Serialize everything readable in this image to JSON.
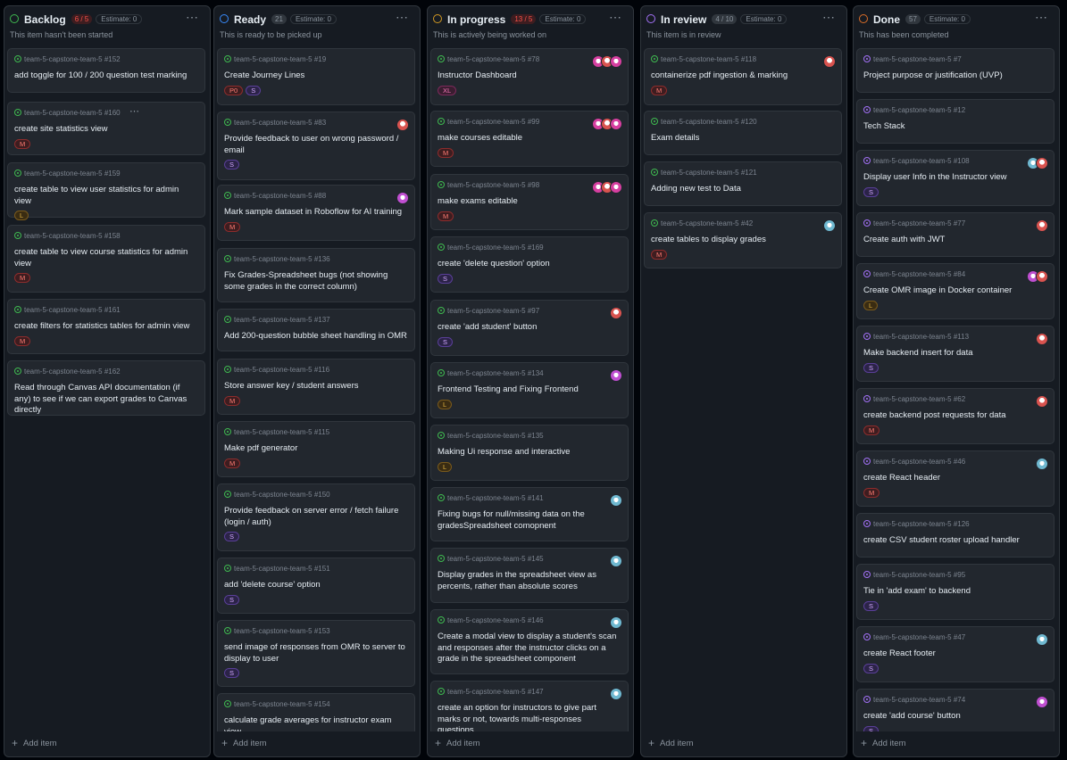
{
  "board": {
    "add_item_label": "Add item",
    "columns": [
      {
        "name": "Backlog",
        "status_color": "#3fb950",
        "count": "6 / 5",
        "count_over": true,
        "estimate": "Estimate: 0",
        "description": "This item hasn't been started",
        "cards": [
          {
            "ref": "team-5-capstone-team-5 #152",
            "title": "add toggle for 100 / 200 question test marking",
            "labels": [],
            "avatars": []
          },
          {
            "ref": "team-5-capstone-team-5 #160",
            "title": "create site statistics view",
            "labels": [
              "M"
            ],
            "avatars": [],
            "menu": true
          },
          {
            "ref": "team-5-capstone-team-5 #159",
            "title": "create table to view user statistics for admin view",
            "labels": [
              "L"
            ],
            "avatars": []
          },
          {
            "ref": "team-5-capstone-team-5 #158",
            "title": "create table to view course statistics for admin view",
            "labels": [
              "M"
            ],
            "avatars": []
          },
          {
            "ref": "team-5-capstone-team-5 #161",
            "title": "create filters for statistics tables for admin view",
            "labels": [
              "M"
            ],
            "avatars": []
          },
          {
            "ref": "team-5-capstone-team-5 #162",
            "title": "Read through Canvas API documentation (if any) to see if we can export grades to Canvas directly",
            "labels": [],
            "avatars": []
          }
        ]
      },
      {
        "name": "Ready",
        "status_color": "#388bfd",
        "count": "21",
        "count_over": false,
        "estimate": "Estimate: 0",
        "description": "This is ready to be picked up",
        "cards": [
          {
            "ref": "team-5-capstone-team-5 #19",
            "title": "Create Journey Lines",
            "labels": [
              "P0",
              "S"
            ],
            "avatars": []
          },
          {
            "ref": "team-5-capstone-team-5 #83",
            "title": "Provide feedback to user on wrong password / email",
            "labels": [
              "S"
            ],
            "avatars": [
              "red"
            ]
          },
          {
            "ref": "team-5-capstone-team-5 #88",
            "title": "Mark sample dataset in Roboflow for AI training",
            "labels": [
              "M"
            ],
            "avatars": [
              "mag"
            ]
          },
          {
            "ref": "team-5-capstone-team-5 #136",
            "title": "Fix Grades-Spreadsheet bugs (not showing some grades in the correct column)",
            "labels": [],
            "avatars": []
          },
          {
            "ref": "team-5-capstone-team-5 #137",
            "title": "Add 200-question bubble sheet handling in OMR",
            "labels": [],
            "avatars": []
          },
          {
            "ref": "team-5-capstone-team-5 #116",
            "title": "Store answer key / student answers",
            "labels": [
              "M"
            ],
            "avatars": []
          },
          {
            "ref": "team-5-capstone-team-5 #115",
            "title": "Make pdf generator",
            "labels": [
              "M"
            ],
            "avatars": []
          },
          {
            "ref": "team-5-capstone-team-5 #150",
            "title": "Provide feedback on server error / fetch failure (login / auth)",
            "labels": [
              "S"
            ],
            "avatars": []
          },
          {
            "ref": "team-5-capstone-team-5 #151",
            "title": "add 'delete course' option",
            "labels": [
              "S"
            ],
            "avatars": []
          },
          {
            "ref": "team-5-capstone-team-5 #153",
            "title": "send image of responses from OMR to server to display to user",
            "labels": [
              "S"
            ],
            "avatars": []
          },
          {
            "ref": "team-5-capstone-team-5 #154",
            "title": "calculate grade averages for instructor exam view",
            "labels": [],
            "avatars": []
          }
        ]
      },
      {
        "name": "In progress",
        "status_color": "#d29922",
        "count": "13 / 5",
        "count_over": true,
        "estimate": "Estimate: 0",
        "description": "This is actively being worked on",
        "cards": [
          {
            "ref": "team-5-capstone-team-5 #78",
            "title": "Instructor Dashboard",
            "labels": [
              "XL"
            ],
            "avatars": [
              "pink",
              "red",
              "pink"
            ]
          },
          {
            "ref": "team-5-capstone-team-5 #99",
            "title": "make courses editable",
            "labels": [
              "M"
            ],
            "avatars": [
              "pink",
              "red",
              "pink"
            ]
          },
          {
            "ref": "team-5-capstone-team-5 #98",
            "title": "make exams editable",
            "labels": [
              "M"
            ],
            "avatars": [
              "pink",
              "red",
              "pink"
            ]
          },
          {
            "ref": "team-5-capstone-team-5 #169",
            "title": "create 'delete question' option",
            "labels": [
              "S"
            ],
            "avatars": []
          },
          {
            "ref": "team-5-capstone-team-5 #97",
            "title": "create 'add student' button",
            "labels": [
              "S"
            ],
            "avatars": [
              "red"
            ]
          },
          {
            "ref": "team-5-capstone-team-5 #134",
            "title": "Frontend Testing and Fixing Frontend",
            "labels": [
              "L"
            ],
            "avatars": [
              "mag"
            ]
          },
          {
            "ref": "team-5-capstone-team-5 #135",
            "title": "Making Ui response and interactive",
            "labels": [
              "L"
            ],
            "avatars": []
          },
          {
            "ref": "team-5-capstone-team-5 #141",
            "title": "Fixing bugs for null/missing data on the gradesSpreadsheet comopnent",
            "labels": [],
            "avatars": [
              "cyan"
            ]
          },
          {
            "ref": "team-5-capstone-team-5 #145",
            "title": "Display grades in the spreadsheet view as percents, rather than absolute scores",
            "labels": [],
            "avatars": [
              "cyan"
            ]
          },
          {
            "ref": "team-5-capstone-team-5 #146",
            "title": "Create a modal view to display a student's scan and responses after the instructor clicks on a grade in the spreadsheet component",
            "labels": [],
            "avatars": [
              "cyan"
            ]
          },
          {
            "ref": "team-5-capstone-team-5 #147",
            "title": "create an option for instructors to give part marks or not, towards multi-responses questions.",
            "labels": [],
            "avatars": [
              "cyan"
            ]
          }
        ]
      },
      {
        "name": "In review",
        "status_color": "#a371f7",
        "count": "4 / 10",
        "count_over": false,
        "estimate": "Estimate: 0",
        "description": "This item is in review",
        "cards": [
          {
            "ref": "team-5-capstone-team-5 #118",
            "title": "containerize pdf ingestion & marking",
            "labels": [
              "M"
            ],
            "avatars": [
              "red"
            ]
          },
          {
            "ref": "team-5-capstone-team-5 #120",
            "title": "Exam details",
            "labels": [],
            "avatars": []
          },
          {
            "ref": "team-5-capstone-team-5 #121",
            "title": "Adding new test to Data",
            "labels": [],
            "avatars": []
          },
          {
            "ref": "team-5-capstone-team-5 #42",
            "title": "create tables to display grades",
            "labels": [
              "M"
            ],
            "avatars": [
              "cyan"
            ]
          }
        ]
      },
      {
        "name": "Done",
        "status_color": "#db6d28",
        "count": "57",
        "count_over": false,
        "estimate": "Estimate: 0",
        "description": "This has been completed",
        "cards": [
          {
            "ref": "team-5-capstone-team-5 #7",
            "title": "Project purpose or justification (UVP)",
            "labels": [],
            "avatars": []
          },
          {
            "ref": "team-5-capstone-team-5 #12",
            "title": "Tech Stack",
            "labels": [],
            "avatars": []
          },
          {
            "ref": "team-5-capstone-team-5 #108",
            "title": "Display user Info in the Instructor view",
            "labels": [
              "S"
            ],
            "avatars": [
              "cyan",
              "red"
            ]
          },
          {
            "ref": "team-5-capstone-team-5 #77",
            "title": "Create auth with JWT",
            "labels": [],
            "avatars": [
              "red"
            ]
          },
          {
            "ref": "team-5-capstone-team-5 #84",
            "title": "Create OMR image in Docker container",
            "labels": [
              "L"
            ],
            "avatars": [
              "mag",
              "red"
            ]
          },
          {
            "ref": "team-5-capstone-team-5 #113",
            "title": "Make backend insert for data",
            "labels": [
              "S"
            ],
            "avatars": [
              "red"
            ]
          },
          {
            "ref": "team-5-capstone-team-5 #62",
            "title": "create backend post requests for data",
            "labels": [
              "M"
            ],
            "avatars": [
              "red"
            ]
          },
          {
            "ref": "team-5-capstone-team-5 #46",
            "title": "create React header",
            "labels": [
              "M"
            ],
            "avatars": [
              "cyan"
            ]
          },
          {
            "ref": "team-5-capstone-team-5 #126",
            "title": "create CSV student roster upload handler",
            "labels": [],
            "avatars": []
          },
          {
            "ref": "team-5-capstone-team-5 #95",
            "title": "Tie in 'add exam' to backend",
            "labels": [
              "S"
            ],
            "avatars": []
          },
          {
            "ref": "team-5-capstone-team-5 #47",
            "title": "create React footer",
            "labels": [
              "S"
            ],
            "avatars": [
              "cyan"
            ]
          },
          {
            "ref": "team-5-capstone-team-5 #74",
            "title": "create 'add course' button",
            "labels": [
              "S"
            ],
            "avatars": [
              "mag"
            ]
          }
        ]
      }
    ]
  }
}
